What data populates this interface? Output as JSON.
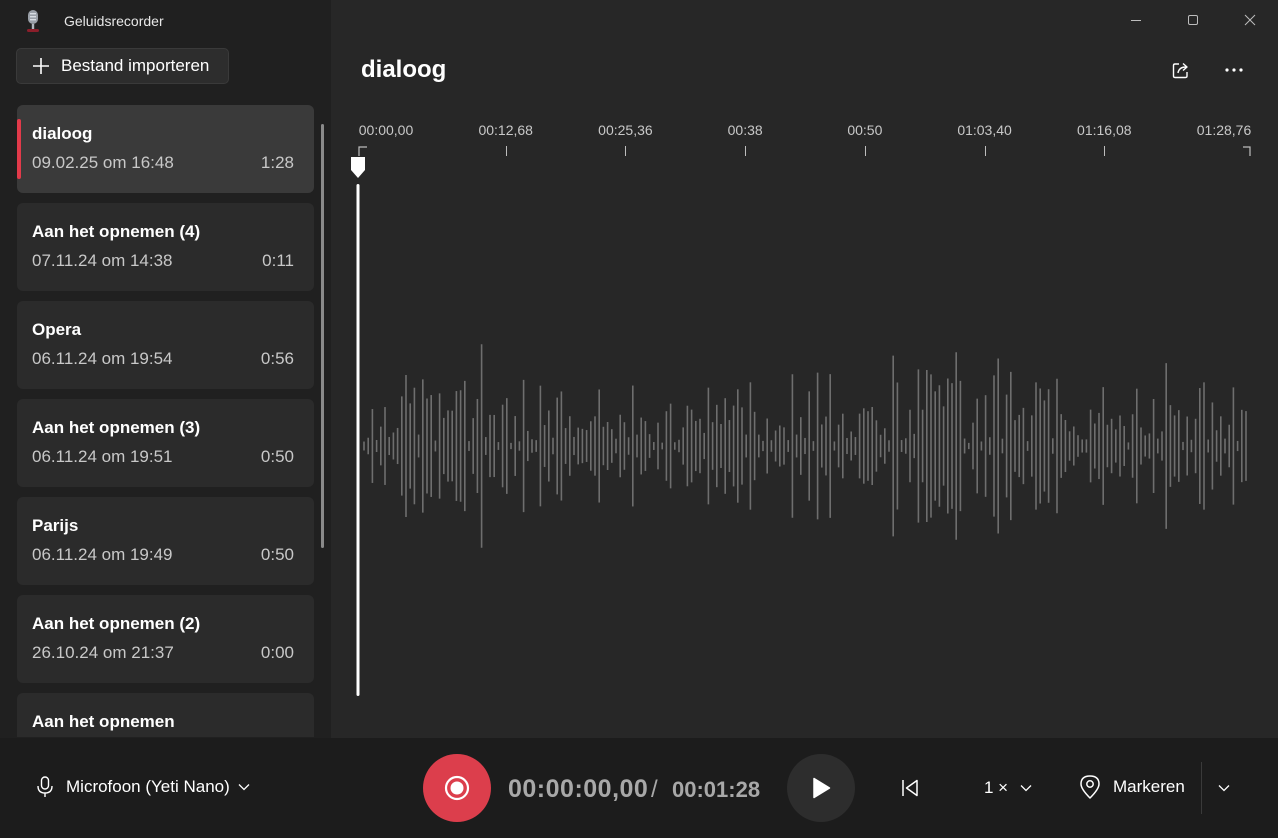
{
  "app": {
    "title": "Geluidsrecorder"
  },
  "sidebar": {
    "import_label": "Bestand importeren",
    "items": [
      {
        "name": "dialoog",
        "date": "09.02.25 om 16:48",
        "duration": "1:28",
        "selected": true
      },
      {
        "name": "Aan het opnemen (4)",
        "date": "07.11.24 om 14:38",
        "duration": "0:11"
      },
      {
        "name": "Opera",
        "date": "06.11.24 om 19:54",
        "duration": "0:56"
      },
      {
        "name": "Aan het opnemen (3)",
        "date": "06.11.24 om 19:51",
        "duration": "0:50"
      },
      {
        "name": "Parijs",
        "date": "06.11.24 om 19:49",
        "duration": "0:50"
      },
      {
        "name": "Aan het opnemen (2)",
        "date": "26.10.24 om 21:37",
        "duration": "0:00"
      },
      {
        "name": "Aan het opnemen",
        "date": "",
        "duration": ""
      }
    ]
  },
  "main": {
    "recording_title": "dialoog",
    "timeline_ticks": [
      "00:00,00",
      "00:12,68",
      "00:25,36",
      "00:38",
      "00:50",
      "01:03,40",
      "01:16,08",
      "01:28,76"
    ],
    "playhead_position": 0
  },
  "controls": {
    "microphone_label": "Microfoon (Yeti Nano)",
    "current_time": "00:00:00,00",
    "separator": "/",
    "total_time": "00:01:28",
    "speed_label": "1 ×",
    "mark_label": "Markeren"
  },
  "colors": {
    "accent_red": "#dc3e4c",
    "selection_bar": "#e23a4a",
    "waveform": "#6e6e6e"
  }
}
